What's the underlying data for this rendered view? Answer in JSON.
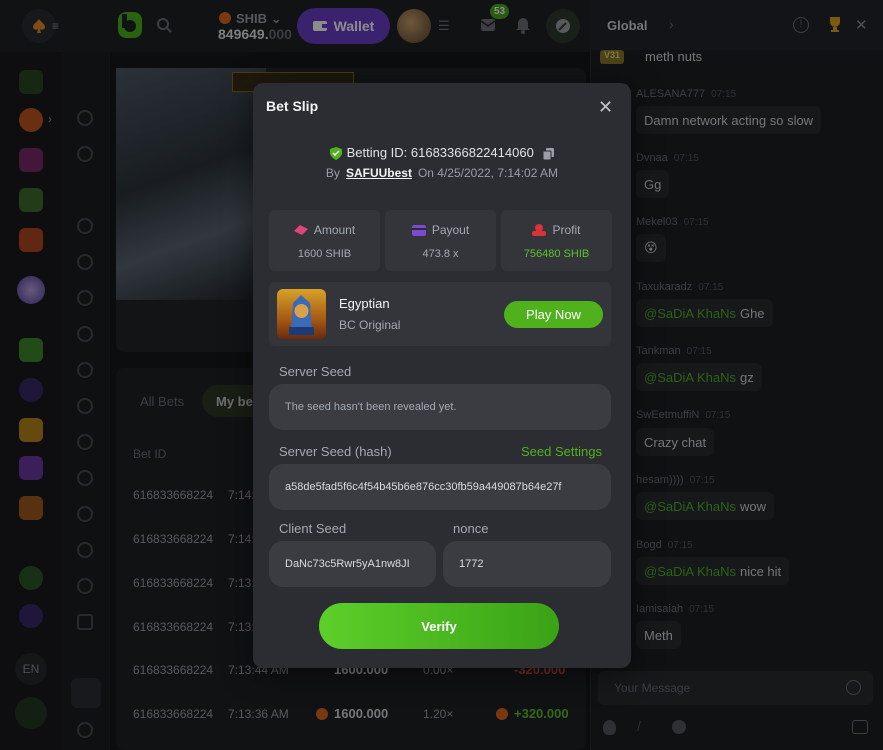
{
  "header": {
    "coin": "SHIB",
    "balance_main": "849649.",
    "balance_dec": "000",
    "wallet_label": "Wallet",
    "notifications_count": "53"
  },
  "sidebar": {
    "language": "EN"
  },
  "bets_panel": {
    "tabs": [
      {
        "label": "All Bets"
      },
      {
        "label": "My bets"
      }
    ],
    "column_header": "Bet ID",
    "rows": [
      {
        "id": "616833668224",
        "time": "7:14:"
      },
      {
        "id": "616833668224",
        "time": "7:14:"
      },
      {
        "id": "616833668224",
        "time": "7:13:"
      },
      {
        "id": "616833668224",
        "time": "7:13:"
      },
      {
        "id": "616833668224",
        "time": "7:13:44 AM",
        "amount": "1600.000",
        "payout": "0.00×",
        "profit": "-320.000"
      },
      {
        "id": "616833668224",
        "time": "7:13:36 AM",
        "amount": "1600.000",
        "payout": "1.20×",
        "profit": "+320.000"
      }
    ]
  },
  "chat": {
    "tab": "Global",
    "input_placeholder": "Your Message",
    "messages": [
      {
        "user": "",
        "time": "",
        "text": "meth nuts",
        "badge": "V31"
      },
      {
        "user": "ALESANA777",
        "time": "07:15",
        "text": "Damn network acting so slow"
      },
      {
        "user": "Dvnaa",
        "time": "07:15",
        "text": "Gg"
      },
      {
        "user": "Mekel03",
        "time": "07:15",
        "text": "😵"
      },
      {
        "user": "Taxukaradz",
        "time": "07:15",
        "mention": "@SaDiA KhaNs",
        "text": "Ghe"
      },
      {
        "user": "Tankman",
        "time": "07:15",
        "mention": "@SaDiA KhaNs",
        "text": "gz"
      },
      {
        "user": "SwEetmuffiN",
        "time": "07:15",
        "text": "Crazy chat"
      },
      {
        "user": "hesam))))",
        "time": "07:15",
        "mention": "@SaDiA KhaNs",
        "text": "wow"
      },
      {
        "user": "Bogd",
        "time": "07:15",
        "mention": "@SaDiA KhaNs",
        "text": "nice hit"
      },
      {
        "user": "Iamisaiah",
        "time": "07:15",
        "text": "Meth"
      }
    ]
  },
  "modal": {
    "title": "Bet Slip",
    "betting_id_label": "Betting ID: 616833668224140​60",
    "by_label": "By",
    "by_user": "SAFUUbest",
    "date": "On 4/25/2022, 7:14:02 AM",
    "amount_label": "Amount",
    "amount_value": "1600 SHIB",
    "payout_label": "Payout",
    "payout_value": "473.8 x",
    "profit_label": "Profit",
    "profit_value": "756480 SHIB",
    "game_name": "Egyptian",
    "game_sub": "BC Original",
    "play_label": "Play Now",
    "server_seed_label": "Server Seed",
    "server_seed_value": "The seed hasn't been revealed yet.",
    "server_hash_label": "Server Seed (hash)",
    "seed_settings": "Seed Settings",
    "server_hash_value": "a58de5fad5f6c4f54b45b6e876cc30fb59a449087b64e27f",
    "client_seed_label": "Client Seed",
    "client_seed_value": "DaNc73c5Rwr5yA1nw8JI",
    "nonce_label": "nonce",
    "nonce_value": "1772",
    "verify_label": "Verify"
  },
  "colors": {
    "accent_green": "#4fb21d",
    "wallet_purple": "#6b3fc9",
    "profit_green": "#5cc22b"
  }
}
